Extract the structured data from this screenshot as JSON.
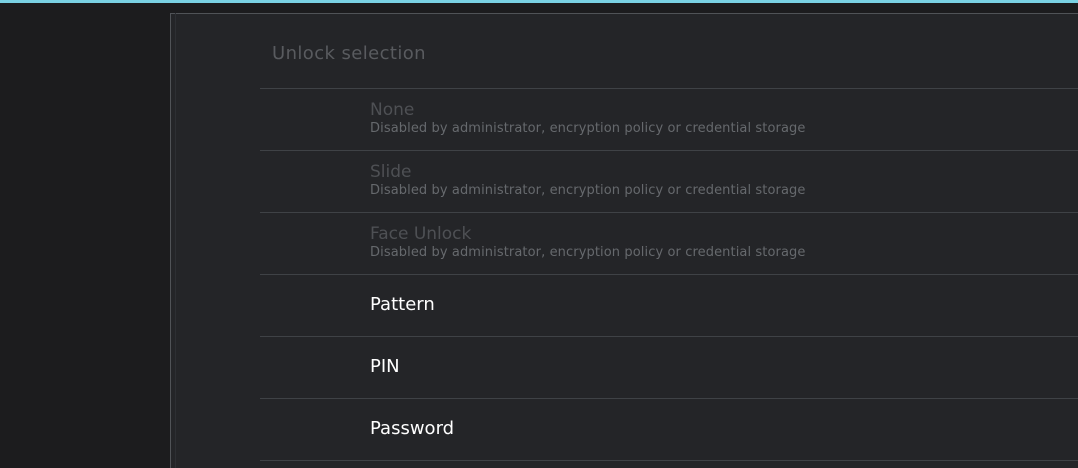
{
  "colors": {
    "background": "#1c1c1e",
    "panel": "#242528",
    "accent": "#7ad1e3",
    "disabled_title": "#4e5054",
    "enabled_title": "#ffffff",
    "summary": "#66696d",
    "divider": "#3f4246"
  },
  "section": {
    "title": "Unlock selection"
  },
  "options": [
    {
      "label": "None",
      "summary": "Disabled by administrator, encryption policy or credential storage",
      "enabled": false
    },
    {
      "label": "Slide",
      "summary": "Disabled by administrator, encryption policy or credential storage",
      "enabled": false
    },
    {
      "label": "Face Unlock",
      "summary": "Disabled by administrator, encryption policy or credential storage",
      "enabled": false
    },
    {
      "label": "Pattern",
      "enabled": true
    },
    {
      "label": "PIN",
      "enabled": true
    },
    {
      "label": "Password",
      "enabled": true
    }
  ]
}
